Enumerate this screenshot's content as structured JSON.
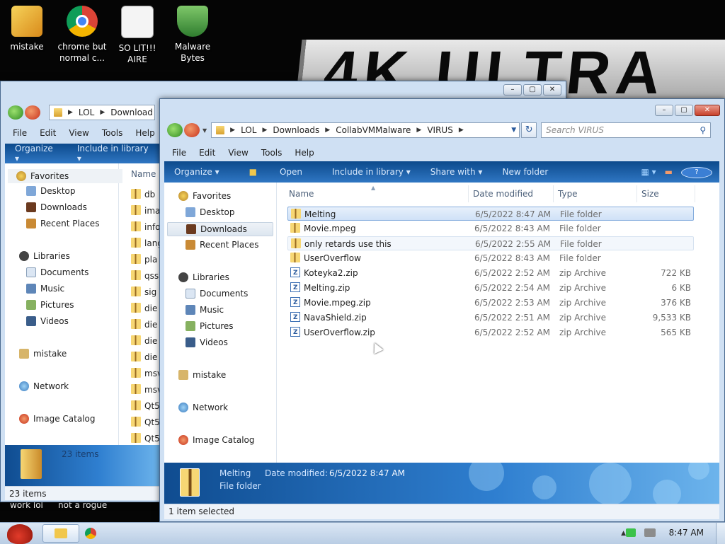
{
  "desktop": {
    "banner_text": "4K ULTRA",
    "icons": [
      {
        "label": "mistake",
        "icon": "mistake-icon"
      },
      {
        "label": "chrome but normal c...",
        "icon": "chrome-icon"
      },
      {
        "label": "SO LIT!!! AIRE",
        "icon": "cards-icon"
      },
      {
        "label": "Malware Bytes",
        "icon": "shield-icon"
      }
    ],
    "bottom_labels": [
      "work lol",
      "not a rogue"
    ]
  },
  "back_window": {
    "breadcrumb": [
      "LOL",
      "Download"
    ],
    "menu": [
      "File",
      "Edit",
      "View",
      "Tools",
      "Help"
    ],
    "toolbar": [
      "Organize ▾",
      "Include in library ▾"
    ],
    "nav": [
      "Favorites",
      "Desktop",
      "Downloads",
      "Recent Places",
      "Libraries",
      "Documents",
      "Music",
      "Pictures",
      "Videos",
      "mistake",
      "Network",
      "Image Catalog"
    ],
    "name_header": "Name",
    "files": [
      "db",
      "ima",
      "info",
      "lang",
      "pla",
      "qss",
      "sig",
      "die",
      "die",
      "die",
      "die",
      "msv",
      "msv",
      "Qt5",
      "Qt5",
      "Qt5",
      "Qt5"
    ],
    "details_count": "23 items",
    "status": "23 items"
  },
  "front_window": {
    "breadcrumb": [
      "LOL",
      "Downloads",
      "CollabVMMalware",
      "VIRUS"
    ],
    "search_placeholder": "Search VIRUS",
    "menu": [
      "File",
      "Edit",
      "View",
      "Tools",
      "Help"
    ],
    "toolbar": {
      "organize": "Organize ▾",
      "open": "Open",
      "include": "Include in library ▾",
      "share": "Share with ▾",
      "new_folder": "New folder"
    },
    "nav": {
      "favorites": "Favorites",
      "desktop": "Desktop",
      "downloads": "Downloads",
      "recent": "Recent Places",
      "libraries": "Libraries",
      "documents": "Documents",
      "music": "Music",
      "pictures": "Pictures",
      "videos": "Videos",
      "mistake": "mistake",
      "network": "Network",
      "catalog": "Image Catalog"
    },
    "columns": {
      "name": "Name",
      "date": "Date modified",
      "type": "Type",
      "size": "Size"
    },
    "files": [
      {
        "name": "Melting",
        "date": "6/5/2022 8:47 AM",
        "type": "File folder",
        "size": "",
        "kind": "folder"
      },
      {
        "name": "Movie.mpeg",
        "date": "6/5/2022 8:43 AM",
        "type": "File folder",
        "size": "",
        "kind": "folder"
      },
      {
        "name": "only retards use this",
        "date": "6/5/2022 2:55 AM",
        "type": "File folder",
        "size": "",
        "kind": "folder"
      },
      {
        "name": "UserOverflow",
        "date": "6/5/2022 8:43 AM",
        "type": "File folder",
        "size": "",
        "kind": "folder"
      },
      {
        "name": "Koteyka2.zip",
        "date": "6/5/2022 2:52 AM",
        "type": "zip Archive",
        "size": "722 KB",
        "kind": "zip"
      },
      {
        "name": "Melting.zip",
        "date": "6/5/2022 2:54 AM",
        "type": "zip Archive",
        "size": "6 KB",
        "kind": "zip"
      },
      {
        "name": "Movie.mpeg.zip",
        "date": "6/5/2022 2:53 AM",
        "type": "zip Archive",
        "size": "376 KB",
        "kind": "zip"
      },
      {
        "name": "NavaShield.zip",
        "date": "6/5/2022 2:51 AM",
        "type": "zip Archive",
        "size": "9,533 KB",
        "kind": "zip"
      },
      {
        "name": "UserOverflow.zip",
        "date": "6/5/2022 2:52 AM",
        "type": "zip Archive",
        "size": "565 KB",
        "kind": "zip"
      }
    ],
    "details": {
      "name": "Melting",
      "date_label": "Date modified:",
      "date_value": "6/5/2022 8:47 AM",
      "type": "File folder"
    },
    "status": "1 item selected"
  },
  "taskbar": {
    "clock": "8:47 AM"
  }
}
